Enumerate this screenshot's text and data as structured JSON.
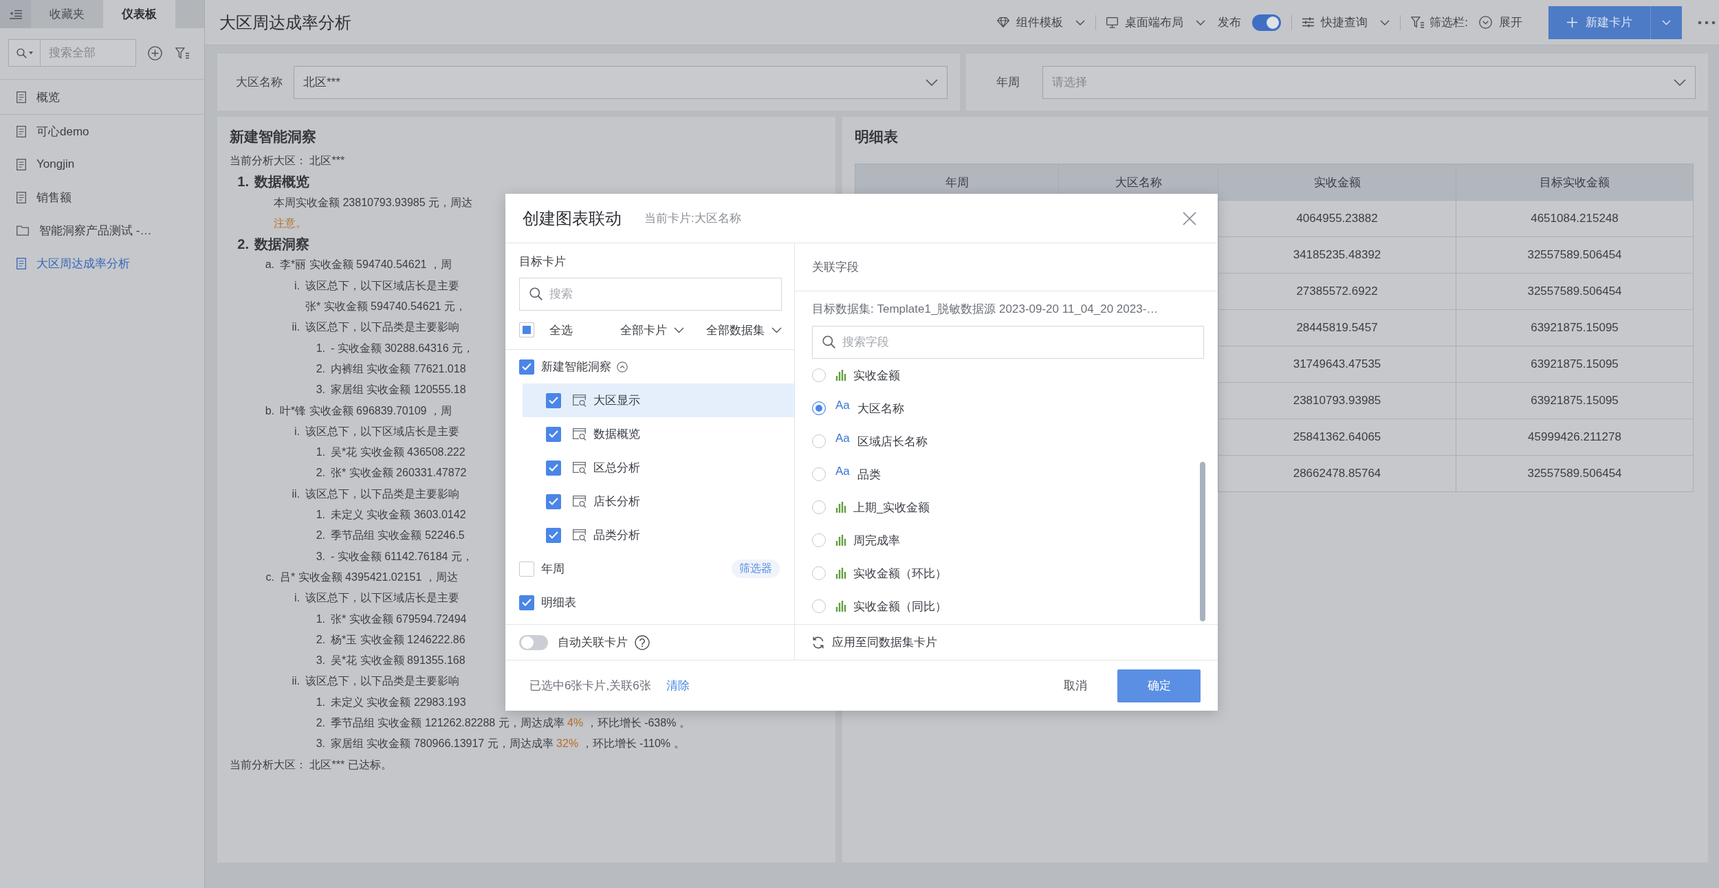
{
  "sidebar": {
    "tabs": [
      {
        "label": "收藏夹",
        "selected": false
      },
      {
        "label": "仪表板",
        "selected": true
      }
    ],
    "search": {
      "placeholder": "搜索全部"
    },
    "pinned": [
      {
        "label": "概览",
        "kind": "page",
        "selected": false
      }
    ],
    "items": [
      {
        "label": "可心demo",
        "kind": "page",
        "selected": false
      },
      {
        "label": "Yongjin",
        "kind": "page",
        "selected": false
      },
      {
        "label": "销售额",
        "kind": "page",
        "selected": false
      },
      {
        "label": "智能洞察产品测试 -…",
        "kind": "folder",
        "selected": false
      },
      {
        "label": "大区周达成率分析",
        "kind": "page",
        "selected": true
      }
    ]
  },
  "header": {
    "title": "大区周达成率分析",
    "template": {
      "label": "组件模板"
    },
    "layout": {
      "label": "桌面端布局"
    },
    "publish": {
      "label": "发布",
      "on": true
    },
    "quick_query": {
      "label": "快捷查询"
    },
    "filter_bar": {
      "label": "筛选栏:",
      "action": "展开"
    },
    "new_card": {
      "label": "新建卡片"
    }
  },
  "filters": [
    {
      "label": "大区名称",
      "value": "北区***"
    },
    {
      "label": "年周",
      "placeholder": "请选择"
    }
  ],
  "insight": {
    "title": "新建智能洞察",
    "intro": "当前分析大区： 北区***",
    "outline": [
      {
        "kind": "heading",
        "marker": "1.",
        "lines": [
          [
            {
              "text": "数据概览",
              "accent": false
            }
          ]
        ],
        "children": [
          {
            "kind": "item",
            "lines": [
              [
                {
                  "text": "本周实收金额 23810793.93985 元，周达",
                  "accent": false
                }
              ],
              [
                {
                  "text": "注意。",
                  "accent": true
                }
              ]
            ]
          }
        ]
      },
      {
        "kind": "heading",
        "marker": "2.",
        "lines": [
          [
            {
              "text": "数据洞察",
              "accent": false
            }
          ]
        ],
        "children": [
          {
            "kind": "item",
            "marker": "a.",
            "lines": [
              [
                {
                  "text": "李*丽 实收金额 594740.54621 ，周",
                  "accent": false
                }
              ]
            ],
            "children": [
              {
                "kind": "item",
                "marker": "i.",
                "lines": [
                  [
                    {
                      "text": "该区总下，以下区域店长是主要",
                      "accent": false
                    }
                  ],
                  [
                    {
                      "text": "张* 实收金额 594740.54621 元，",
                      "accent": false
                    }
                  ]
                ]
              },
              {
                "kind": "item",
                "marker": "ii.",
                "lines": [
                  [
                    {
                      "text": "该区总下，以下品类是主要影响",
                      "accent": false
                    }
                  ]
                ],
                "children": [
                  {
                    "kind": "item",
                    "marker": "1.",
                    "lines": [
                      [
                        {
                          "text": "- 实收金额 30288.64316 元，",
                          "accent": false
                        }
                      ]
                    ]
                  },
                  {
                    "kind": "item",
                    "marker": "2.",
                    "lines": [
                      [
                        {
                          "text": "内裤组 实收金额 77621.018",
                          "accent": false
                        }
                      ]
                    ]
                  },
                  {
                    "kind": "item",
                    "marker": "3.",
                    "lines": [
                      [
                        {
                          "text": "家居组 实收金额 120555.18",
                          "accent": false
                        }
                      ]
                    ]
                  }
                ]
              }
            ]
          },
          {
            "kind": "item",
            "marker": "b.",
            "lines": [
              [
                {
                  "text": "叶*锋 实收金额 696839.70109 ，周",
                  "accent": false
                }
              ]
            ],
            "children": [
              {
                "kind": "item",
                "marker": "i.",
                "lines": [
                  [
                    {
                      "text": "该区总下，以下区域店长是主要",
                      "accent": false
                    }
                  ]
                ],
                "children": [
                  {
                    "kind": "item",
                    "marker": "1.",
                    "lines": [
                      [
                        {
                          "text": "吴*花 实收金额 436508.222",
                          "accent": false
                        }
                      ]
                    ]
                  },
                  {
                    "kind": "item",
                    "marker": "2.",
                    "lines": [
                      [
                        {
                          "text": "张* 实收金额 260331.47872",
                          "accent": false
                        }
                      ]
                    ]
                  }
                ]
              },
              {
                "kind": "item",
                "marker": "ii.",
                "lines": [
                  [
                    {
                      "text": "该区总下，以下品类是主要影响",
                      "accent": false
                    }
                  ]
                ],
                "children": [
                  {
                    "kind": "item",
                    "marker": "1.",
                    "lines": [
                      [
                        {
                          "text": "未定义 实收金额 3603.0142",
                          "accent": false
                        }
                      ]
                    ]
                  },
                  {
                    "kind": "item",
                    "marker": "2.",
                    "lines": [
                      [
                        {
                          "text": "季节品组 实收金额 52246.5",
                          "accent": false
                        }
                      ]
                    ]
                  },
                  {
                    "kind": "item",
                    "marker": "3.",
                    "lines": [
                      [
                        {
                          "text": "- 实收金额 61142.76184 元，",
                          "accent": false
                        }
                      ]
                    ]
                  }
                ]
              }
            ]
          },
          {
            "kind": "item",
            "marker": "c.",
            "lines": [
              [
                {
                  "text": "吕* 实收金额 4395421.02151 ，周达",
                  "accent": false
                }
              ]
            ],
            "children": [
              {
                "kind": "item",
                "marker": "i.",
                "lines": [
                  [
                    {
                      "text": "该区总下，以下区域店长是主要",
                      "accent": false
                    }
                  ]
                ],
                "children": [
                  {
                    "kind": "item",
                    "marker": "1.",
                    "lines": [
                      [
                        {
                          "text": "张* 实收金额 679594.72494",
                          "accent": false
                        }
                      ]
                    ]
                  },
                  {
                    "kind": "item",
                    "marker": "2.",
                    "lines": [
                      [
                        {
                          "text": "杨*玉 实收金额 1246222.86",
                          "accent": false
                        }
                      ]
                    ]
                  },
                  {
                    "kind": "item",
                    "marker": "3.",
                    "lines": [
                      [
                        {
                          "text": "吴*花 实收金额 891355.168",
                          "accent": false
                        }
                      ]
                    ]
                  }
                ]
              },
              {
                "kind": "item",
                "marker": "ii.",
                "lines": [
                  [
                    {
                      "text": "该区总下，以下品类是主要影响",
                      "accent": false
                    }
                  ]
                ],
                "children": [
                  {
                    "kind": "item",
                    "marker": "1.",
                    "lines": [
                      [
                        {
                          "text": "未定义 实收金额 22983.193",
                          "accent": false
                        }
                      ]
                    ]
                  },
                  {
                    "kind": "item",
                    "marker": "2.",
                    "lines": [
                      [
                        {
                          "text": "季节品组 实收金额 121262.82288 元，周达成率 ",
                          "accent": false
                        },
                        {
                          "text": "4%",
                          "accent": true
                        },
                        {
                          "text": " ，环比增长 -638% 。",
                          "accent": false
                        }
                      ]
                    ]
                  },
                  {
                    "kind": "item",
                    "marker": "3.",
                    "lines": [
                      [
                        {
                          "text": "家居组 实收金额 780966.13917 元，周达成率 ",
                          "accent": false
                        },
                        {
                          "text": "32%",
                          "accent": true
                        },
                        {
                          "text": " ，环比增长 -110% 。",
                          "accent": false
                        }
                      ]
                    ]
                  }
                ]
              }
            ]
          }
        ]
      }
    ],
    "outro": "当前分析大区： 北区*** 已达标。"
  },
  "detail_table": {
    "title": "明细表",
    "columns": [
      "年周",
      "大区名称",
      "实收金额",
      "目标实收金额"
    ],
    "rows": [
      {
        "actual_amount": "4064955.23882",
        "target_amount": "4651084.215248"
      },
      {
        "actual_amount": "34185235.48392",
        "target_amount": "32557589.506454"
      },
      {
        "actual_amount": "27385572.6922",
        "target_amount": "32557589.506454"
      },
      {
        "actual_amount": "28445819.5457",
        "target_amount": "63921875.15095"
      },
      {
        "actual_amount": "31749643.47535",
        "target_amount": "63921875.15095"
      },
      {
        "actual_amount": "23810793.93985",
        "target_amount": "63921875.15095"
      },
      {
        "actual_amount": "25841362.64065",
        "target_amount": "45999426.211278"
      },
      {
        "actual_amount": "28662478.85764",
        "target_amount": "32557589.506454"
      }
    ]
  },
  "dialog": {
    "title": "创建图表联动",
    "subtitle": "当前卡片:大区名称",
    "cards_panel": {
      "heading": "目标卡片",
      "search": {
        "placeholder": "搜索"
      },
      "select_all": {
        "label": "全选",
        "checked": false,
        "indeterminate": true
      },
      "card_filter": {
        "label": "全部卡片"
      },
      "dataset_filter": {
        "label": "全部数据集"
      },
      "cards": [
        {
          "label": "新建智能洞察",
          "checked": true,
          "selected": false,
          "expanded": true,
          "children": [
            {
              "label": "大区显示",
              "checked": true,
              "selected": true
            },
            {
              "label": "数据概览",
              "checked": true,
              "selected": false
            },
            {
              "label": "区总分析",
              "checked": true,
              "selected": false
            },
            {
              "label": "店长分析",
              "checked": true,
              "selected": false
            },
            {
              "label": "品类分析",
              "checked": true,
              "selected": false
            }
          ]
        },
        {
          "label": "年周",
          "checked": false,
          "selected": false,
          "tag": "筛选器"
        },
        {
          "label": "明细表",
          "checked": true,
          "selected": false
        }
      ],
      "auto_link": {
        "label": "自动关联卡片",
        "on": false
      }
    },
    "fields_panel": {
      "heading": "关联字段",
      "dataset": "目标数据集: Template1_脱敏数据源 2023-09-20 11_04_20 2023-…",
      "search": {
        "placeholder": "搜索字段"
      },
      "fields": [
        {
          "label": "实收金额",
          "kind": "measure",
          "selected": false
        },
        {
          "label": "大区名称",
          "kind": "dimension",
          "type_text": "Aa",
          "selected": true
        },
        {
          "label": "区域店长名称",
          "kind": "dimension",
          "type_text": "Aa",
          "selected": false
        },
        {
          "label": "品类",
          "kind": "dimension",
          "type_text": "Aa",
          "selected": false
        },
        {
          "label": "上期_实收金额",
          "kind": "measure",
          "selected": false
        },
        {
          "label": "周完成率",
          "kind": "measure",
          "selected": false
        },
        {
          "label": "实收金额（环比）",
          "kind": "measure",
          "selected": false
        },
        {
          "label": "实收金额（同比）",
          "kind": "measure",
          "selected": false
        }
      ],
      "apply": "应用至同数据集卡片"
    },
    "footer": {
      "summary": "已选中6张卡片,关联6张",
      "clear": "清除",
      "cancel": "取消",
      "confirm": "确定"
    }
  }
}
